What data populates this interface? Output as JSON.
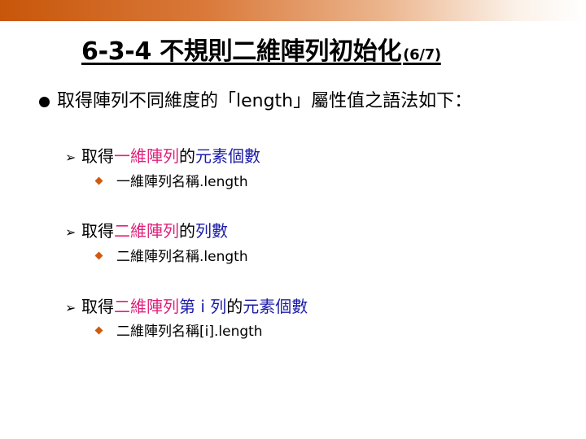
{
  "slide": {
    "title": "6-3-4 不規則二維陣列初始化",
    "title_suffix": "(6/7)",
    "bullet_main": "取得陣列不同維度的「length」屬性值之語法如下：",
    "items": [
      {
        "prefix": "取得",
        "highlight": "一維陣列",
        "mid": "的",
        "tail": "元素個數",
        "syntax": "一維陣列名稱.length"
      },
      {
        "prefix": "取得",
        "highlight": "二維陣列",
        "mid": "的",
        "tail": "列數",
        "syntax": "二維陣列名稱.length"
      },
      {
        "prefix": "取得",
        "highlight": "二維陣列",
        "mid": "第 i 列",
        "mid2": "的",
        "tail": "元素個數",
        "syntax": "二維陣列名稱[i].length"
      }
    ]
  },
  "colors": {
    "highlight_pink": "#e0217b",
    "highlight_blue": "#1b1ba8",
    "band_orange": "#c8560a",
    "sub_bullet_orange": "#d05a10"
  },
  "icons": {
    "level1": "filled-circle-bullet",
    "level2": "arrow-bullet",
    "level3": "diamond-bullet"
  }
}
